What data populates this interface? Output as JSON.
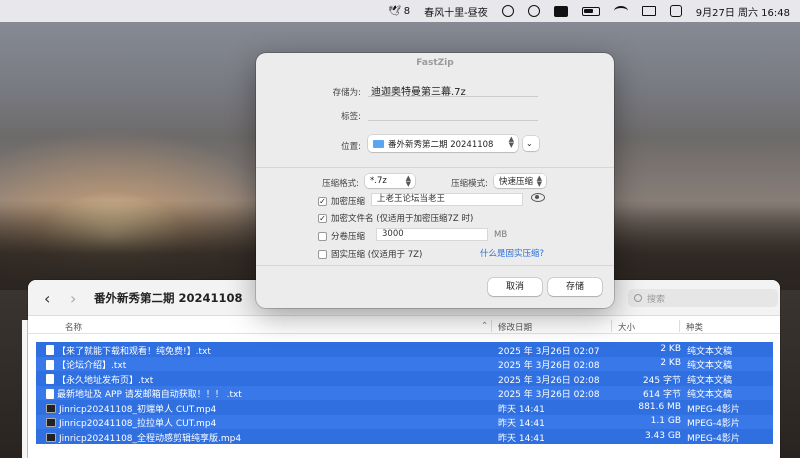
{
  "menubar": {
    "app_badge": "8",
    "now_playing": "春风十里-昼夜",
    "date_time": "9月27日 周六  16:48",
    "icons": [
      "bird-icon",
      "globe-icon",
      "play-icon",
      "input-method-icon",
      "battery-icon",
      "wifi-icon",
      "screen-mirror-icon",
      "control-center-icon"
    ]
  },
  "dialog": {
    "title": "FastZip",
    "save_as_label": "存储为:",
    "save_as_value": "迪迦奥特曼第三幕.7z",
    "tags_label": "标签:",
    "location_label": "位置:",
    "location_value": "番外新秀第二期 20241108",
    "format_label": "压缩格式:",
    "format_value": "*.7z",
    "mode_label": "压缩模式:",
    "mode_value": "快速压缩",
    "encrypt_label": "加密压缩",
    "encrypt_checked": true,
    "password_value": "上老王论坛当老王",
    "encrypt_names_label": "加密文件名 (仅适用于加密压缩7Z 时)",
    "encrypt_names_checked": true,
    "split_label": "分卷压缩",
    "split_checked": false,
    "split_value": "3000",
    "split_unit": "MB",
    "solid_label": "固实压缩 (仅适用于 7Z)",
    "solid_checked": false,
    "solid_help_link": "什么是固实压缩?",
    "cancel_label": "取消",
    "save_label": "存储"
  },
  "finder": {
    "title": "番外新秀第二期 20241108",
    "search_placeholder": "搜索",
    "columns": {
      "name": "名称",
      "modified": "修改日期",
      "size": "大小",
      "kind": "种类"
    },
    "rows": [
      {
        "name": "【来了就能下载和观看！纯免费!】.txt",
        "modified": "2025 年 3月26日 02:07",
        "size": "2 KB",
        "kind": "纯文本文稿",
        "icon": "text-file-icon"
      },
      {
        "name": "【论坛介绍】.txt",
        "modified": "2025 年 3月26日 02:08",
        "size": "2 KB",
        "kind": "纯文本文稿",
        "icon": "text-file-icon"
      },
      {
        "name": "【永久地址发布页】.txt",
        "modified": "2025 年 3月26日 02:08",
        "size": "245 字节",
        "kind": "纯文本文稿",
        "icon": "text-file-icon"
      },
      {
        "name": "最新地址及 APP 请发邮箱自动获取！！！ .txt",
        "modified": "2025 年 3月26日 02:08",
        "size": "614 字节",
        "kind": "纯文本文稿",
        "icon": "text-file-icon"
      },
      {
        "name": "Jinricp20241108_初端单人 CUT.mp4",
        "modified": "昨天 14:41",
        "size": "881.6 MB",
        "kind": "MPEG-4影片",
        "icon": "video-file-icon"
      },
      {
        "name": "Jinricp20241108_拉拉单人 CUT.mp4",
        "modified": "昨天 14:41",
        "size": "1.1 GB",
        "kind": "MPEG-4影片",
        "icon": "video-file-icon"
      },
      {
        "name": "Jinricp20241108_全程动感剪辑纯享版.mp4",
        "modified": "昨天 14:41",
        "size": "3.43 GB",
        "kind": "MPEG-4影片",
        "icon": "video-file-icon"
      }
    ]
  }
}
